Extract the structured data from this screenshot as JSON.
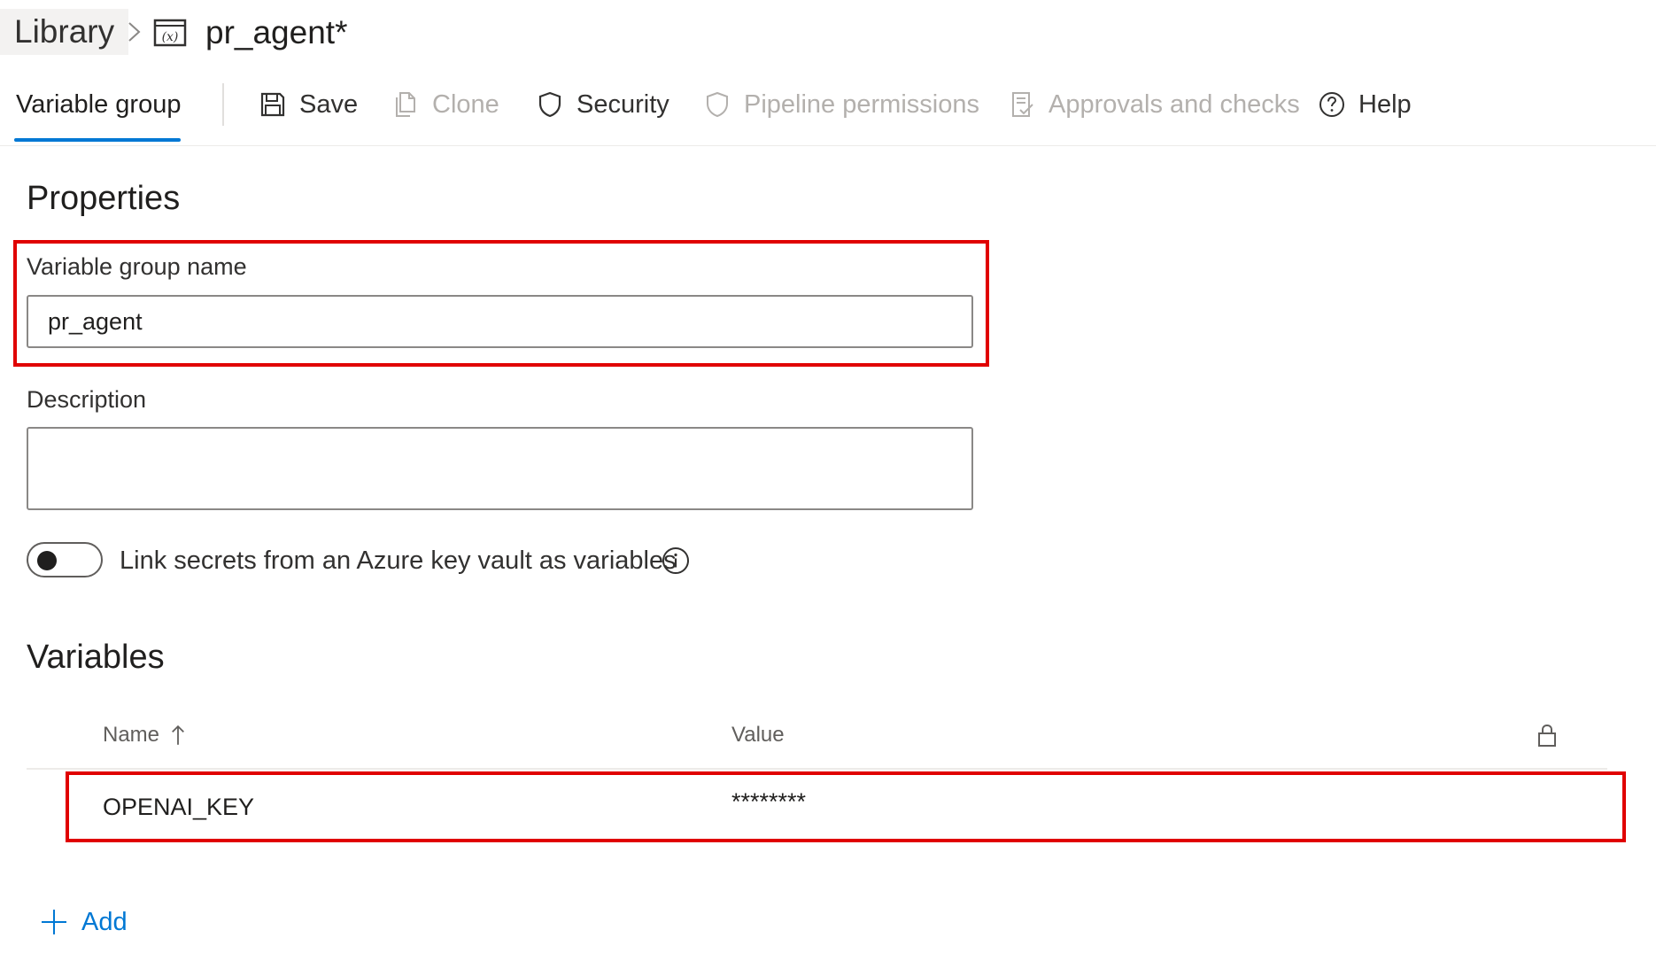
{
  "breadcrumb": {
    "library_label": "Library",
    "title": "pr_agent*"
  },
  "toolbar": {
    "active_tab": "Variable group",
    "save": "Save",
    "clone": "Clone",
    "security": "Security",
    "pipeline_permissions": "Pipeline permissions",
    "approvals_checks": "Approvals and checks",
    "help": "Help"
  },
  "properties": {
    "heading": "Properties",
    "name_label": "Variable group name",
    "name_value": "pr_agent",
    "description_label": "Description",
    "description_value": "",
    "keyvault_toggle_label": "Link secrets from an Azure key vault as variables",
    "keyvault_toggle_on": false
  },
  "variables": {
    "heading": "Variables",
    "columns": {
      "name": "Name",
      "value": "Value"
    },
    "rows": [
      {
        "name": "OPENAI_KEY",
        "value": "********",
        "secret": true
      }
    ],
    "add_label": "Add"
  },
  "colors": {
    "accent": "#0078d4",
    "highlight": "#e00000",
    "disabled_text": "#b3b0ad"
  },
  "icons": [
    "chevron-right-icon",
    "variable-group-icon",
    "save-icon",
    "clone-icon",
    "shield-icon",
    "shield-outline-icon",
    "checklist-icon",
    "help-icon",
    "info-icon",
    "arrow-up-icon",
    "lock-icon",
    "plus-icon"
  ]
}
